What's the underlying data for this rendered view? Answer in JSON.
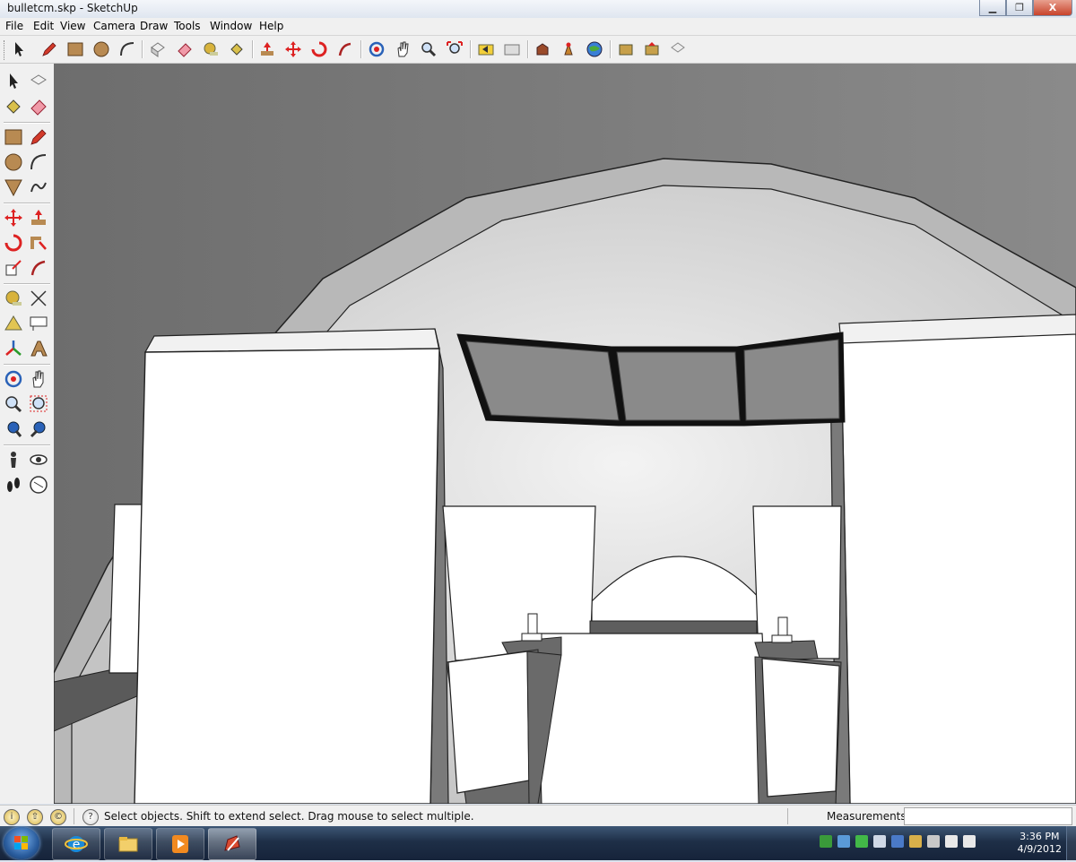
{
  "window": {
    "title": "bulletcm.skp - SketchUp",
    "min_label": "▁",
    "max_label": "❐",
    "close_label": "X"
  },
  "menu": {
    "file": "File",
    "edit": "Edit",
    "view": "View",
    "camera": "Camera",
    "draw": "Draw",
    "tools": "Tools",
    "window": "Window",
    "help": "Help"
  },
  "toolbar_icons": [
    "select-icon",
    "pencil-icon",
    "rectangle-icon",
    "circle-icon",
    "arc-icon",
    "make-component-icon",
    "eraser-icon",
    "tape-measure-icon",
    "paint-bucket-icon",
    "push-pull-icon",
    "move-icon",
    "rotate-icon",
    "follow-me-icon",
    "orbit-icon",
    "pan-icon",
    "zoom-icon",
    "zoom-extents-icon",
    "previous-view-icon",
    "next-view-icon",
    "get-models-icon",
    "share-model-icon",
    "google-earth-icon",
    "component-icon",
    "share-component-icon",
    "extension-icon"
  ],
  "left_tools": [
    "select-icon",
    "make-component-icon",
    "paint-bucket-icon",
    "eraser-icon",
    "rectangle-icon",
    "pencil-icon",
    "circle-icon",
    "arc-icon",
    "polygon-icon",
    "freehand-icon",
    "move-icon",
    "push-pull-icon",
    "rotate-icon",
    "follow-me-icon",
    "scale-icon",
    "offset-icon",
    "tape-measure-icon",
    "dimension-icon",
    "protractor-icon",
    "text-icon",
    "axes-icon",
    "3d-text-icon",
    "orbit-icon",
    "pan-icon",
    "zoom-icon",
    "zoom-window-icon",
    "zoom-extents-icon",
    "previous-icon",
    "position-camera-icon",
    "look-around-icon",
    "walk-icon",
    "section-plane-icon"
  ],
  "status": {
    "hint": "Select objects. Shift to extend select. Drag mouse to select multiple.",
    "help_glyph": "?",
    "info_glyph_1": "i",
    "info_glyph_2": "⇧",
    "info_glyph_3": "©",
    "measurements_label": "Measurements",
    "measurements_value": ""
  },
  "taskbar": {
    "time": "3:36 PM",
    "date": "4/9/2012",
    "apps": [
      "internet-explorer-icon",
      "file-explorer-icon",
      "media-player-icon",
      "sketchup-icon"
    ]
  },
  "colors": {
    "background": "#7d7d7d",
    "face_white": "#ffffff",
    "dome": "#d8d8d8",
    "window_glass": "#8a8a8a"
  }
}
